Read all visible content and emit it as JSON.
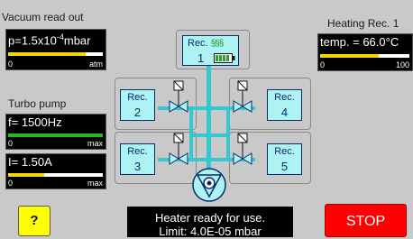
{
  "vacuum": {
    "title": "Vacuum read out",
    "reading": "p=1.5x10",
    "reading_exp": "-4",
    "reading_unit": "mbar",
    "scale_min": "0",
    "scale_max": "atm",
    "fill_fraction": 0.82,
    "fill_color": "#f5d800"
  },
  "turbo": {
    "title": "Turbo pump",
    "frequency": "f= 1500Hz",
    "freq_min": "0",
    "freq_max": "max",
    "freq_fill_fraction": 1.0,
    "freq_fill_color": "#22bb22",
    "current": "I= 1.50A",
    "cur_min": "0",
    "cur_max": "max",
    "cur_fill_fraction": 0.38,
    "cur_fill_color": "#f5d800"
  },
  "heating": {
    "title": "Heating Rec. 1",
    "reading": "temp. = 66.0°C",
    "scale_min": "0",
    "scale_max": "100",
    "fill_fraction": 0.66,
    "fill_color": "#f5d800"
  },
  "receptacles": {
    "r1": {
      "label": "Rec.",
      "num": "1"
    },
    "r2": {
      "label": "Rec.",
      "num": "2"
    },
    "r3": {
      "label": "Rec.",
      "num": "3"
    },
    "r4": {
      "label": "Rec.",
      "num": "4"
    },
    "r5": {
      "label": "Rec.",
      "num": "5"
    }
  },
  "heater_symbol": "§§§",
  "buttons": {
    "help": "?",
    "stop": "STOP"
  },
  "message": {
    "line1": "Heater ready for use.",
    "line2": "Limit: 4.0E-05 mbar"
  },
  "colors": {
    "background": "#c9c9c9",
    "pipe": "#35c8ce",
    "receptacle": "#aef3f3",
    "stop": "#ff0000",
    "help": "#ffff00"
  }
}
